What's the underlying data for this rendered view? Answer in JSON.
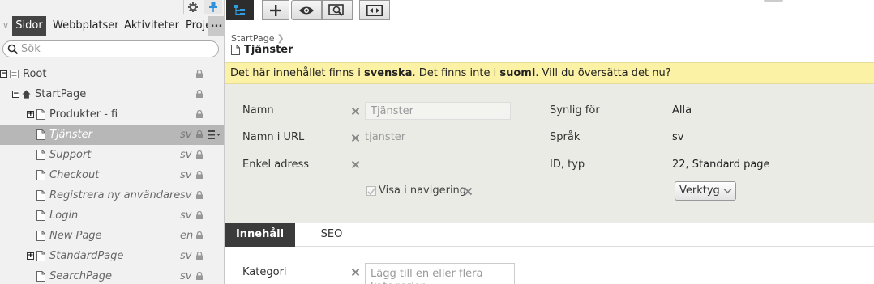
{
  "left_pane": {
    "tabs": [
      "Sidor",
      "Webbplatser",
      "Aktiviteter",
      "Proje"
    ],
    "tab_more": "...",
    "search_placeholder": "Sök",
    "tree": [
      {
        "label": "Root",
        "lang": "",
        "level": 0,
        "toggle": "-",
        "icon": "root",
        "italic": false,
        "selected": false
      },
      {
        "label": "StartPage",
        "lang": "",
        "level": 1,
        "toggle": "-",
        "icon": "home",
        "italic": false,
        "selected": false
      },
      {
        "label": "Produkter - fi",
        "lang": "",
        "level": 2,
        "toggle": "+",
        "icon": "page",
        "italic": false,
        "selected": false
      },
      {
        "label": "Tjänster",
        "lang": "sv",
        "level": 2,
        "toggle": "",
        "icon": "page",
        "italic": true,
        "selected": true
      },
      {
        "label": "Support",
        "lang": "sv",
        "level": 2,
        "toggle": "",
        "icon": "page",
        "italic": true,
        "selected": false
      },
      {
        "label": "Checkout",
        "lang": "sv",
        "level": 2,
        "toggle": "",
        "icon": "page",
        "italic": true,
        "selected": false
      },
      {
        "label": "Registrera ny användare",
        "lang": "sv",
        "level": 2,
        "toggle": "",
        "icon": "page",
        "italic": true,
        "selected": false
      },
      {
        "label": "Login",
        "lang": "sv",
        "level": 2,
        "toggle": "",
        "icon": "page",
        "italic": true,
        "selected": false
      },
      {
        "label": "New Page",
        "lang": "en",
        "level": 2,
        "toggle": "",
        "icon": "page",
        "italic": true,
        "selected": false
      },
      {
        "label": "StandardPage",
        "lang": "sv",
        "level": 2,
        "toggle": "+",
        "icon": "page",
        "italic": true,
        "selected": false
      },
      {
        "label": "SearchPage",
        "lang": "sv",
        "level": 2,
        "toggle": "",
        "icon": "page",
        "italic": true,
        "selected": false
      }
    ]
  },
  "main": {
    "breadcrumb": "StartPage",
    "page_title": "Tjänster",
    "banner": {
      "part1": "Det här innehållet finns i ",
      "lang1": "svenska",
      "part2": ". Det finns inte i ",
      "lang2": "suomi",
      "part3": ". Vill du översätta det nu?"
    },
    "properties": {
      "name_label": "Namn",
      "name_value": "Tjänster",
      "url_label": "Namn i URL",
      "url_value": "tjanster",
      "simple_label": "Enkel adress",
      "nav_label": "Visa i navigering",
      "visible_label": "Synlig för",
      "visible_value": "Alla",
      "lang_label": "Språk",
      "lang_value": "sv",
      "id_label": "ID, typ",
      "id_value": "22, Standard page",
      "tools_label": "Verktyg"
    },
    "tabs": [
      "Innehåll",
      "SEO"
    ],
    "category_label": "Kategori",
    "category_placeholder": "Lägg till en eller flera kategorier"
  }
}
